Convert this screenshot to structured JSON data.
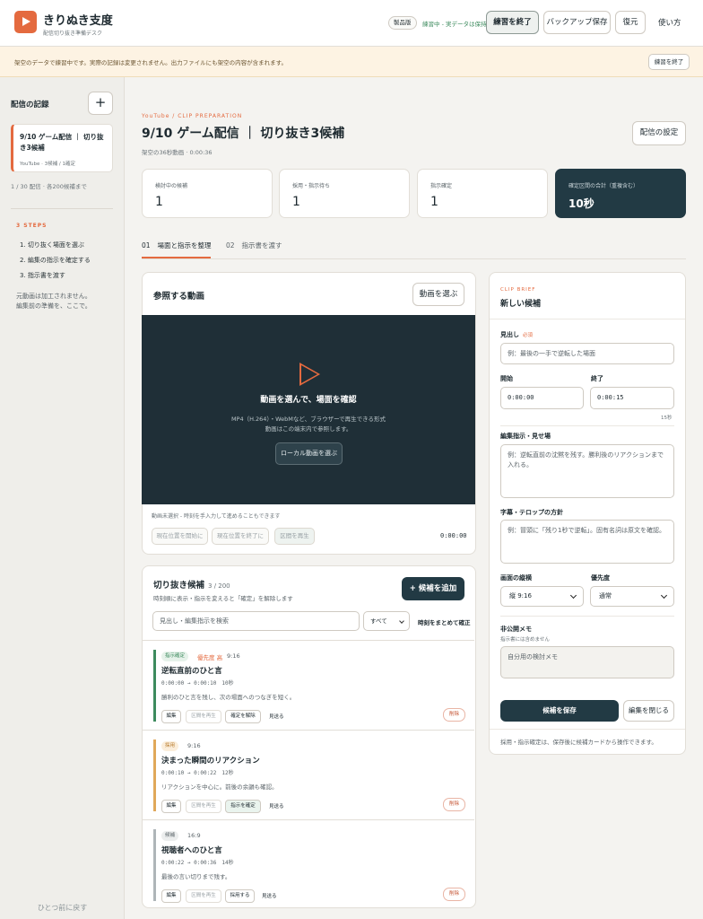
{
  "header": {
    "app_title": "きりぬき支度",
    "app_subtitle": "配信切り抜き準備デスク",
    "edition_badge": "製品版",
    "practice_status": "練習中 - 実データは保持",
    "buttons": {
      "end_practice": "練習を終了",
      "backup": "バックアップ保存",
      "restore": "復元"
    },
    "help_link": "使い方"
  },
  "notice": {
    "text": "架空のデータで練習中です。実際の記録は変更されません。出力ファイルにも架空の内容が含まれます。",
    "button": "練習を終了"
  },
  "sidebar": {
    "title": "配信の記録",
    "add_label": "+",
    "stream": {
      "title": "9/10 ゲーム配信 ｜ 切り抜き3候補",
      "meta": "YouTube · 3候補 / 1確定"
    },
    "count": "1 / 30 配信 · 各200候補まで",
    "steps_heading": "3 STEPS",
    "steps": [
      "1. 切り抜く場面を選ぶ",
      "2. 編集の指示を確定する",
      "3. 指示書を渡す"
    ],
    "note_lines": [
      "元動画は加工されません。",
      "編集前の準備を、ここで。"
    ],
    "back": "ひとつ前に戻す"
  },
  "main": {
    "eyebrow": "YouTube / CLIP PREPARATION",
    "title": "9/10 ゲーム配信 ｜ 切り抜き3候補",
    "subtitle": "架空の36秒動画 · 0:00:36",
    "settings_button": "配信の設定",
    "stats": [
      {
        "label": "検討中の候補",
        "value": "1"
      },
      {
        "label": "採用・指示待ち",
        "value": "1"
      },
      {
        "label": "指示確定",
        "value": "1"
      },
      {
        "label": "確定区間の合計（重複含む）",
        "value": "10秒"
      }
    ],
    "tabs": [
      {
        "num": "01",
        "label": "場面と指示を整理"
      },
      {
        "num": "02",
        "label": "指示書を渡す"
      }
    ]
  },
  "video": {
    "title": "参照する動画",
    "choose_button": "動画を選ぶ",
    "heading": "動画を選んで、場面を確認",
    "desc_line1": "MP4（H.264）・WebMなど、ブラウザーで再生できる形式",
    "desc_line2": "動画はこの端末内で参照します。",
    "local_button": "ローカル動画を選ぶ",
    "hint": "動画未選択 - 時刻を手入力して進めることもできます",
    "controls": [
      "現在位置を開始に",
      "現在位置を終了に",
      "区間を再生"
    ],
    "time": "0:00:00"
  },
  "candidates": {
    "title": "切り抜き候補",
    "count": "3 / 200",
    "subtitle": "時刻順に表示・指示を変えると「確定」を解除します",
    "add_button": "+ 候補を追加",
    "search_placeholder": "見出し・編集指示を検索",
    "filter": "すべて",
    "bulk_confirm": "時刻をまとめて確正",
    "items": [
      {
        "badge": "指示確定",
        "priority": "優先度 高",
        "ratio": "9:16",
        "title": "逆転直前のひと言",
        "time": "0:00:00 → 0:00:10　10秒",
        "note": "勝利のひと言を残し、次の場面へのつなぎを短く。",
        "buttons": [
          "編集",
          "区間を再生",
          "確定を解除"
        ],
        "send": "見送る",
        "delete": "削除"
      },
      {
        "badge": "採用",
        "priority": "",
        "ratio": "9:16",
        "title": "決まった瞬間のリアクション",
        "time": "0:00:10 → 0:00:22　12秒",
        "note": "リアクションを中心に。前後の余韻も確認。",
        "buttons": [
          "編集",
          "区間を再生",
          "指示を確定"
        ],
        "send": "見送る",
        "delete": "削除"
      },
      {
        "badge": "候補",
        "priority": "",
        "ratio": "16:9",
        "title": "視聴者へのひと言",
        "time": "0:00:22 → 0:00:36　14秒",
        "note": "最後の言い切りまで残す。",
        "buttons": [
          "編集",
          "区間を再生",
          "採用する"
        ],
        "send": "見送る",
        "delete": "削除"
      }
    ]
  },
  "brief": {
    "eyebrow": "CLIP BRIEF",
    "title": "新しい候補",
    "headline_label": "見出し",
    "required": "必須",
    "headline_placeholder": "例：最後の一手で逆転した場面",
    "start_label": "開始",
    "start_value": "0:00:00",
    "end_label": "終了",
    "end_value": "0:00:15",
    "duration": "15秒",
    "edit_label": "編集指示・見せ場",
    "edit_placeholder": "例：逆転直前の沈黙を残す。勝利後のリアクションまで入れる。",
    "caption_label": "字幕・テロップの方針",
    "caption_placeholder": "例：冒頭に「残り1秒で逆転」。固有名詞は原文を確認。",
    "ratio_label": "画面の縦横",
    "ratio_value": "縦 9:16",
    "priority_label": "優先度",
    "priority_value": "通常",
    "memo_label": "非公開メモ",
    "memo_hint": "指示書には含めません",
    "memo_placeholder": "自分用の検討メモ",
    "save_button": "候補を保存",
    "close_button": "編集を閉じる",
    "footer": "採用・指示確定は、保存後に候補カードから操作できます。"
  },
  "colors": {
    "accent": "#e46a3f",
    "dark": "#223a44",
    "confirmed": "#3d8b5e",
    "adopted": "#e0a85a",
    "candidate": "#aeb5b8"
  }
}
